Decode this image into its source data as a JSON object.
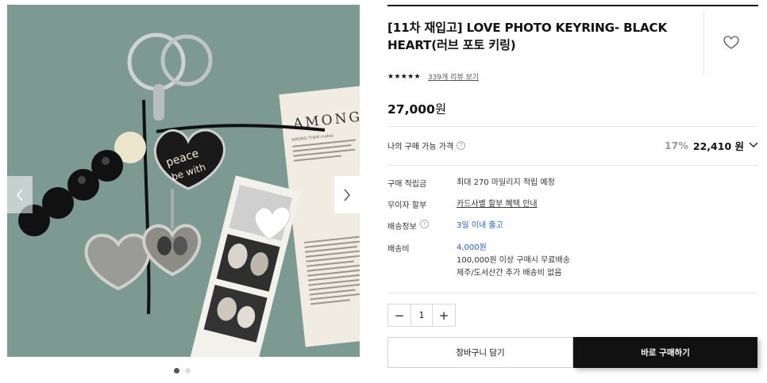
{
  "product": {
    "title": "[11차 재입고] LOVE PHOTO KEYRING- BLACK HEART(러브 포토 키링)",
    "stars": "★★★★★",
    "review_link": "339개 리뷰 보기",
    "price_value": "27,000",
    "price_unit": "원"
  },
  "my_price": {
    "label": "나의 구매 가능 가격",
    "info_icon": "question-icon",
    "discount": "17%",
    "price": "22,410 원",
    "expand_icon": "chevron-down-icon"
  },
  "details": {
    "points_label": "구매 적립금",
    "points_value": "최대 270 마일리지 적립 예정",
    "installment_label": "무이자 할부",
    "installment_value": "카드사별 할부 혜택 안내",
    "shipping_label": "배송정보",
    "shipping_value": "3일 이내 출고",
    "fee_label": "배송비",
    "fee_value": "4,000원",
    "fee_note1": "100,000원 이상 구매시 무료배송",
    "fee_note2": "제주/도서산간 추가 배송비 없음"
  },
  "quantity": {
    "minus": "−",
    "value": "1",
    "plus": "+"
  },
  "buttons": {
    "cart": "장바구니 담기",
    "buy": "바로 구매하기"
  },
  "gallery": {
    "card_heading": "AMONG",
    "card_text": "AMONG THEM makes",
    "prev_icon": "chevron-left-icon",
    "next_icon": "chevron-right-icon",
    "slide_count": 2,
    "active_slide": 1
  },
  "colors": {
    "background_green": "#7d9a92",
    "link_blue": "#1e5fce",
    "buy_button": "#111111"
  }
}
